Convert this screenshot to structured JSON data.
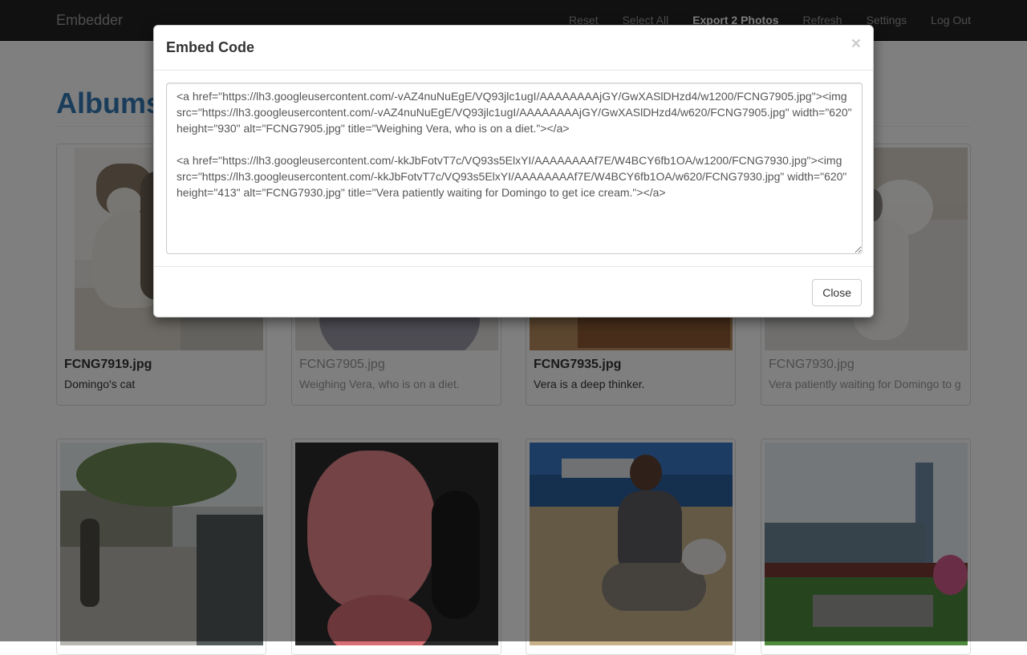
{
  "navbar": {
    "brand": "Embedder",
    "links": [
      "Reset",
      "Select All",
      "Export 2 Photos",
      "Refresh",
      "Settings",
      "Log Out"
    ]
  },
  "page": {
    "title": "Albums"
  },
  "cards": [
    {
      "filename": "FCNG7919.jpg",
      "caption": "Domingo's cat"
    },
    {
      "filename": "FCNG7905.jpg",
      "caption": "Weighing Vera, who is on a diet."
    },
    {
      "filename": "FCNG7935.jpg",
      "caption": "Vera is a deep thinker."
    },
    {
      "filename": "FCNG7930.jpg",
      "caption": "Vera patiently waiting for Domingo to g"
    }
  ],
  "modal": {
    "title": "Embed Code",
    "close_symbol": "×",
    "embed_code": "<a href=\"https://lh3.googleusercontent.com/-vAZ4nuNuEgE/VQ93jlc1ugI/AAAAAAAAjGY/GwXASlDHzd4/w1200/FCNG7905.jpg\"><img src=\"https://lh3.googleusercontent.com/-vAZ4nuNuEgE/VQ93jlc1ugI/AAAAAAAAjGY/GwXASlDHzd4/w620/FCNG7905.jpg\" width=\"620\" height=\"930\" alt=\"FCNG7905.jpg\" title=\"Weighing Vera, who is on a diet.\"></a>\n\n<a href=\"https://lh3.googleusercontent.com/-kkJbFotvT7c/VQ93s5ElxYI/AAAAAAAAf7E/W4BCY6fb1OA/w1200/FCNG7930.jpg\"><img src=\"https://lh3.googleusercontent.com/-kkJbFotvT7c/VQ93s5ElxYI/AAAAAAAAf7E/W4BCY6fb1OA/w620/FCNG7930.jpg\" width=\"620\" height=\"413\" alt=\"FCNG7930.jpg\" title=\"Vera patiently waiting for Domingo to get ice cream.\"></a>",
    "close_button": "Close"
  },
  "colors": {
    "navbar_bg": "#222222",
    "title_blue": "#337ab7",
    "backdrop": "rgba(0,0,0,0.5)"
  }
}
